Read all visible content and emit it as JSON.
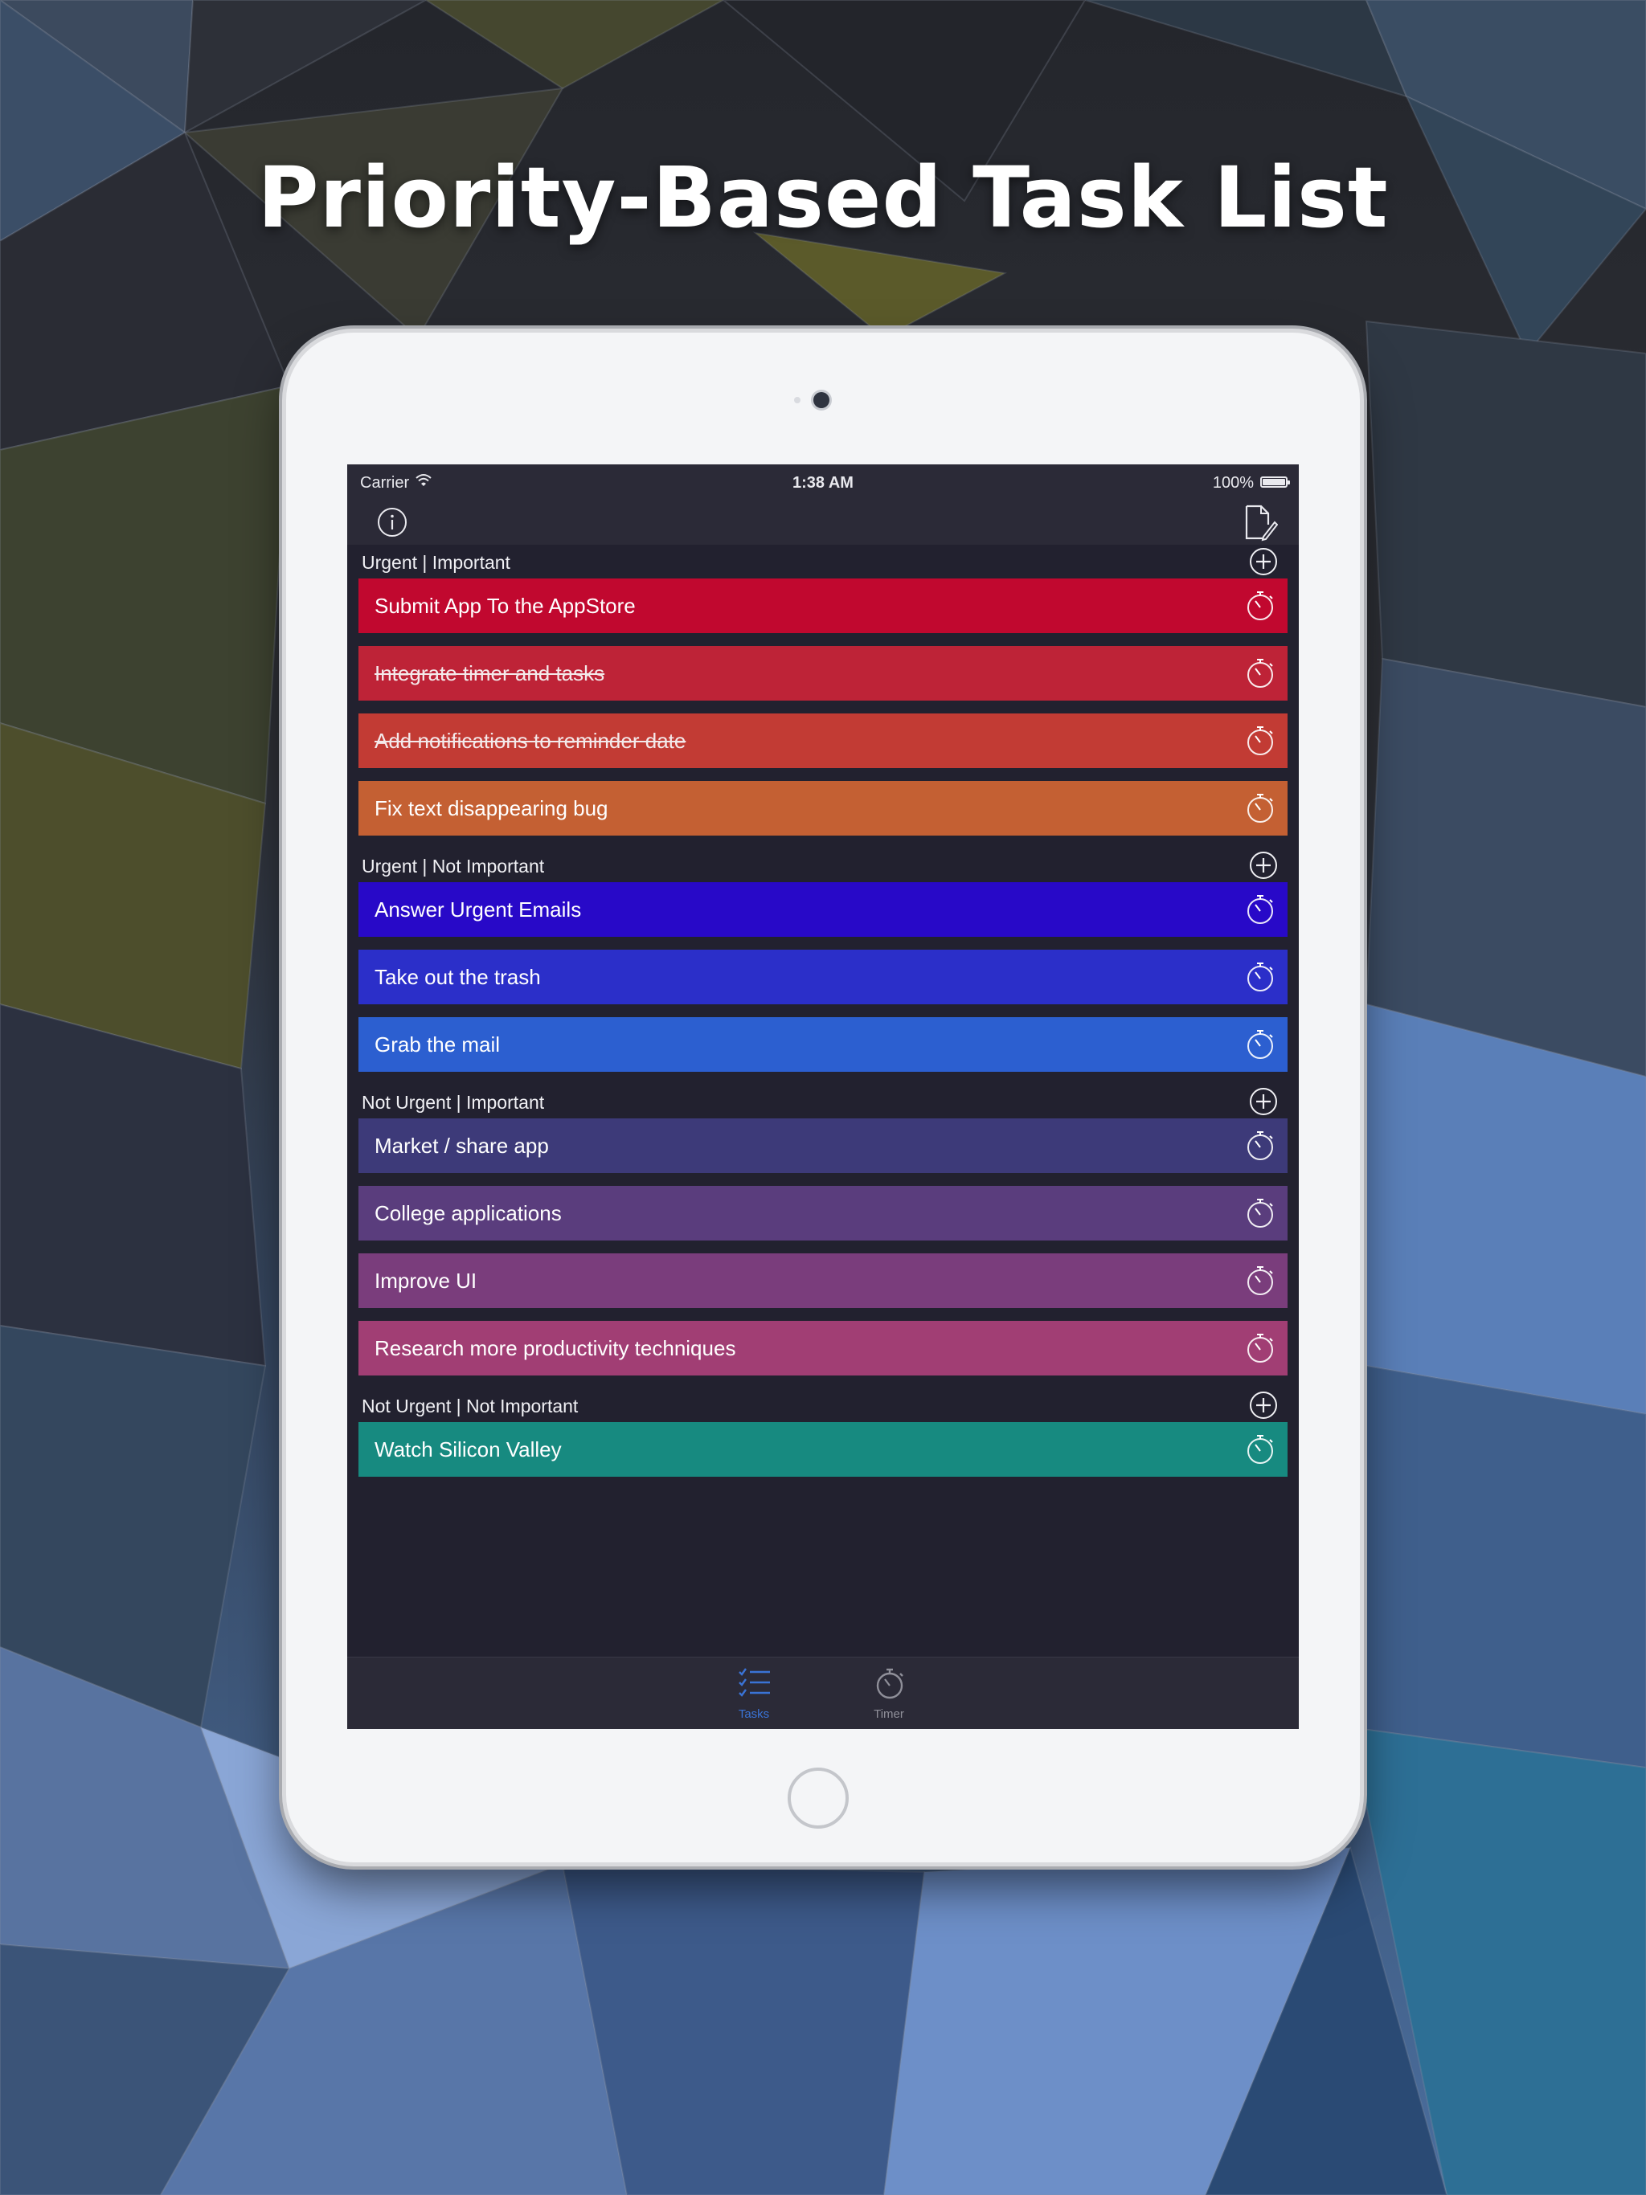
{
  "headline": "Priority-Based Task List",
  "status_bar": {
    "carrier": "Carrier",
    "time": "1:38 AM",
    "battery": "100%"
  },
  "sections": [
    {
      "title": "Urgent | Important",
      "tasks": [
        {
          "title": "Submit App To the AppStore",
          "completed": false,
          "color": "#c1082f"
        },
        {
          "title": "Integrate timer and tasks",
          "completed": true,
          "color": "#be2337"
        },
        {
          "title": "Add notifications to reminder date",
          "completed": true,
          "color": "#c23b34"
        },
        {
          "title": "Fix text disappearing bug",
          "completed": false,
          "color": "#c46033"
        }
      ]
    },
    {
      "title": "Urgent | Not Important",
      "tasks": [
        {
          "title": "Answer Urgent Emails",
          "completed": false,
          "color": "#2809c8"
        },
        {
          "title": "Take out the trash",
          "completed": false,
          "color": "#2b2fc9"
        },
        {
          "title": "Grab the mail",
          "completed": false,
          "color": "#2c5fd0"
        }
      ]
    },
    {
      "title": "Not Urgent | Important",
      "tasks": [
        {
          "title": "Market / share app",
          "completed": false,
          "color": "#3d3a79"
        },
        {
          "title": "College applications",
          "completed": false,
          "color": "#5a3d7d"
        },
        {
          "title": "Improve UI",
          "completed": false,
          "color": "#7a3d7c"
        },
        {
          "title": "Research more productivity techniques",
          "completed": false,
          "color": "#a13e74"
        }
      ]
    },
    {
      "title": "Not Urgent | Not Important",
      "tasks": [
        {
          "title": "Watch Silicon Valley",
          "completed": false,
          "color": "#178a80"
        }
      ]
    }
  ],
  "tabs": [
    {
      "label": "Tasks",
      "selected": true,
      "icon": "checklist-icon"
    },
    {
      "label": "Timer",
      "selected": false,
      "icon": "stopwatch-icon"
    }
  ],
  "colors": {
    "screen_bg": "#22212f",
    "bar_bg": "#2b2a37",
    "accent": "#3a73d6"
  }
}
